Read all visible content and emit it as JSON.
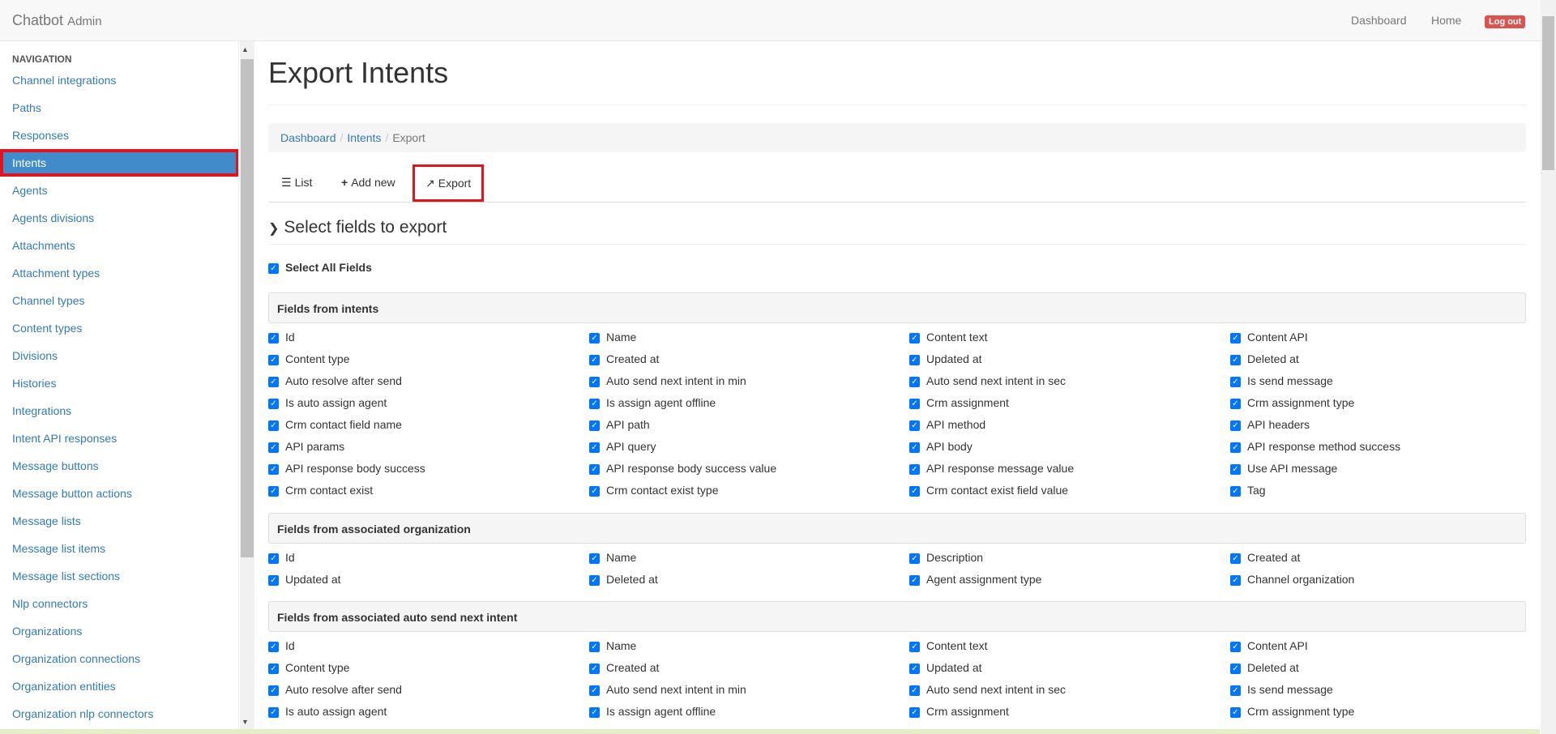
{
  "navbar": {
    "brand": "Chatbot",
    "brand_sub": "Admin",
    "dashboard": "Dashboard",
    "home": "Home",
    "logout": "Log out"
  },
  "sidebar": {
    "header": "NAVIGATION",
    "items": [
      "Channel integrations",
      "Paths",
      "Responses",
      "Intents",
      "Agents",
      "Agents divisions",
      "Attachments",
      "Attachment types",
      "Channel types",
      "Content types",
      "Divisions",
      "Histories",
      "Integrations",
      "Intent API responses",
      "Message buttons",
      "Message button actions",
      "Message lists",
      "Message list items",
      "Message list sections",
      "Nlp connectors",
      "Organizations",
      "Organization connections",
      "Organization entities",
      "Organization nlp connectors"
    ],
    "active": "Intents"
  },
  "page": {
    "title": "Export Intents",
    "breadcrumb": [
      "Dashboard",
      "Intents",
      "Export"
    ],
    "tabs": {
      "list": "List",
      "add_new": "Add new",
      "export": "Export"
    },
    "section_title": "Select fields to export",
    "select_all": "Select All Fields"
  },
  "groups": [
    {
      "title": "Fields from intents",
      "fields": [
        "Id",
        "Name",
        "Content text",
        "Content API",
        "Content type",
        "Created at",
        "Updated at",
        "Deleted at",
        "Auto resolve after send",
        "Auto send next intent in min",
        "Auto send next intent in sec",
        "Is send message",
        "Is auto assign agent",
        "Is assign agent offline",
        "Crm assignment",
        "Crm assignment type",
        "Crm contact field name",
        "API path",
        "API method",
        "API headers",
        "API params",
        "API query",
        "API body",
        "API response method success",
        "API response body success",
        "API response body success value",
        "API response message value",
        "Use API message",
        "Crm contact exist",
        "Crm contact exist type",
        "Crm contact exist field value",
        "Tag"
      ]
    },
    {
      "title": "Fields from associated organization",
      "fields": [
        "Id",
        "Name",
        "Description",
        "Created at",
        "Updated at",
        "Deleted at",
        "Agent assignment type",
        "Channel organization"
      ]
    },
    {
      "title": "Fields from associated auto send next intent",
      "fields": [
        "Id",
        "Name",
        "Content text",
        "Content API",
        "Content type",
        "Created at",
        "Updated at",
        "Deleted at",
        "Auto resolve after send",
        "Auto send next intent in min",
        "Auto send next intent in sec",
        "Is send message",
        "Is auto assign agent",
        "Is assign agent offline",
        "Crm assignment",
        "Crm assignment type"
      ]
    }
  ],
  "colors": {
    "link": "#337ab7",
    "active_bg": "#428bca",
    "highlight": "#e3121f",
    "logout": "#d9534f",
    "checkbox": "#0075ff"
  }
}
